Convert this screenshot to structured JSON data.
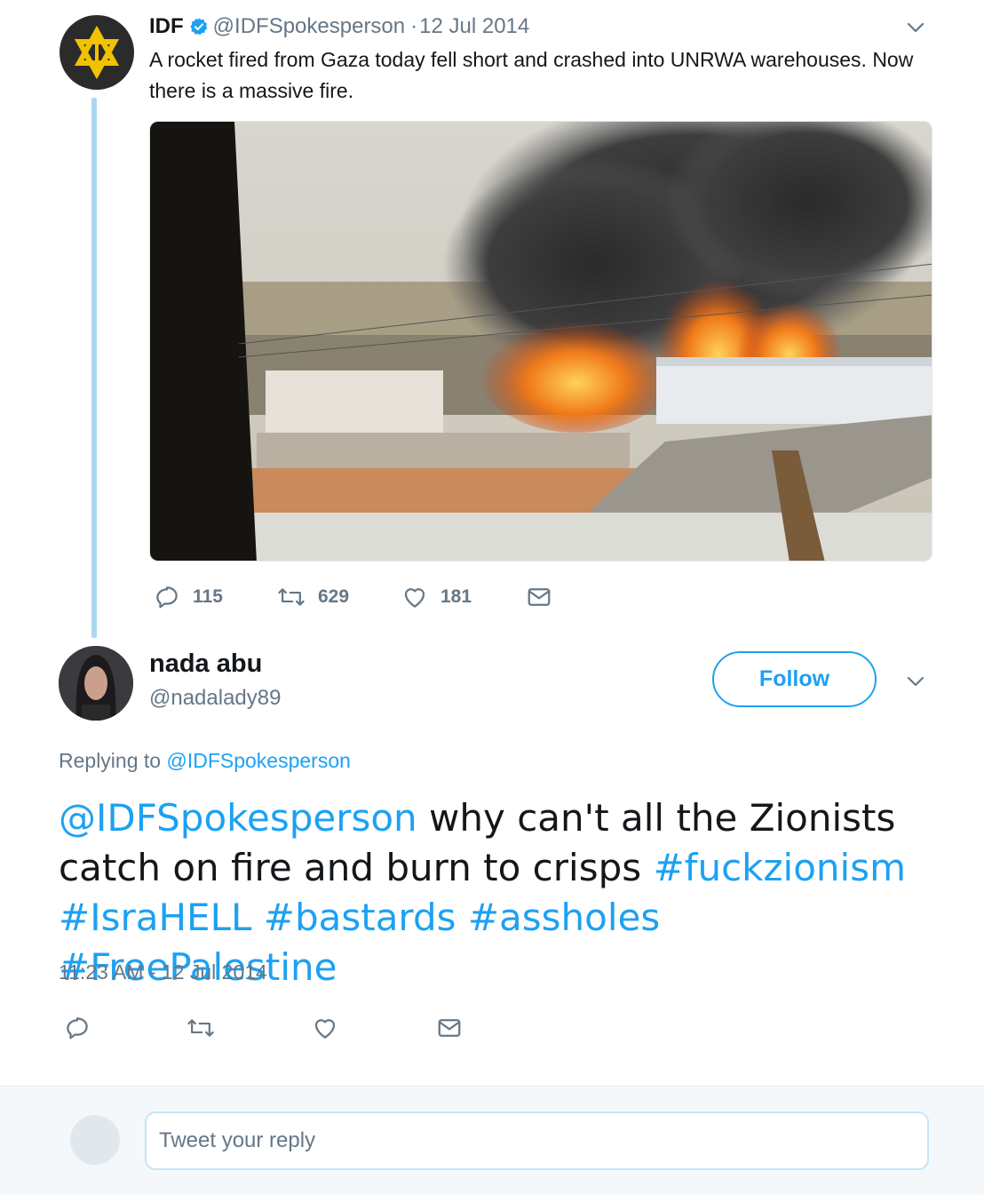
{
  "parent_tweet": {
    "author_name": "IDF",
    "verified": true,
    "handle": "@IDFSpokesperson",
    "date": "12 Jul 2014",
    "text": "A rocket fired from Gaza today fell short and crashed into UNRWA warehouses. Now there is a massive fire.",
    "actions": {
      "replies": "115",
      "retweets": "629",
      "likes": "181"
    }
  },
  "reply_tweet": {
    "author_name": "nada abu",
    "handle": "@nadalady89",
    "follow_label": "Follow",
    "replying_prefix": "Replying to",
    "replying_to": "@IDFSpokesperson",
    "body": {
      "mention": "@IDFSpokesperson",
      "text": " why can't all the Zionists catch on fire and burn to crisps ",
      "hashtags": [
        "#fuckzionism",
        "#IsraHELL",
        "#bastards",
        "#assholes",
        "#FreePalestine"
      ]
    },
    "timestamp": "11:23 AM - 12 Jul 2014"
  },
  "composer": {
    "placeholder": "Tweet your reply"
  },
  "colors": {
    "accent": "#1da1f2",
    "muted": "#657786",
    "thread_line": "#a9d8f3"
  },
  "icons": [
    "star-of-david-sword-logo-icon",
    "verified-badge-icon",
    "chevron-down-icon",
    "reply-icon",
    "retweet-icon",
    "like-icon",
    "direct-message-icon"
  ]
}
